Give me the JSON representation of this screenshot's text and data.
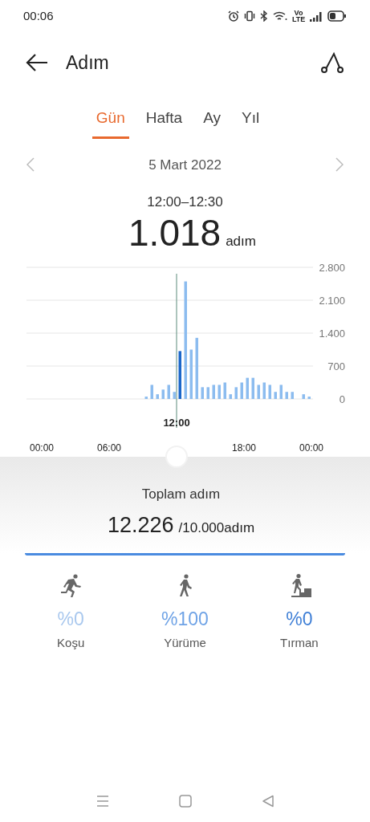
{
  "status_bar": {
    "time": "00:06",
    "volte": "Vo LTE"
  },
  "header": {
    "title": "Adım"
  },
  "tabs": [
    {
      "label": "Gün",
      "selected": true
    },
    {
      "label": "Hafta",
      "selected": false
    },
    {
      "label": "Ay",
      "selected": false
    },
    {
      "label": "Yıl",
      "selected": false
    }
  ],
  "date_nav": {
    "date": "5 Mart 2022"
  },
  "selection": {
    "range": "12:00–12:30",
    "value": "1.018",
    "unit": "adım"
  },
  "chart_data": {
    "type": "bar",
    "x": [
      9,
      9.5,
      10,
      10.5,
      11,
      11.5,
      12,
      12.5,
      13,
      13.5,
      14,
      14.5,
      15,
      15.5,
      16,
      16.5,
      17,
      17.5,
      18,
      18.5,
      19,
      19.5,
      20,
      20.5,
      21,
      21.5,
      22,
      23,
      23.5
    ],
    "series": [
      {
        "color": "#8cbcef",
        "values": [
          50,
          300,
          100,
          200,
          300,
          150,
          null,
          2500,
          1050,
          1300,
          250,
          250,
          300,
          300,
          350,
          100,
          250,
          350,
          450,
          450,
          300,
          350,
          300,
          150,
          300,
          150,
          150,
          100,
          50
        ]
      },
      {
        "color": "#1a66c9",
        "values": [
          null,
          null,
          null,
          null,
          null,
          null,
          1018,
          null,
          null,
          null,
          null,
          null,
          null,
          null,
          null,
          null,
          null,
          null,
          null,
          null,
          null,
          null,
          null,
          null,
          null,
          null,
          null,
          null,
          null
        ]
      }
    ],
    "stacked": true,
    "grid": true,
    "xlim": [
      0,
      24
    ],
    "ylim": [
      0,
      2800
    ],
    "yticks": [
      {
        "value": 0,
        "label": "0"
      },
      {
        "value": 700,
        "label": "700"
      },
      {
        "value": 1400,
        "label": "1.400"
      },
      {
        "value": 2100,
        "label": "2.100"
      },
      {
        "value": 2800,
        "label": "2.800"
      }
    ],
    "xticks": [
      {
        "value": 0,
        "label": "00:00"
      },
      {
        "value": 6,
        "label": "06:00"
      },
      {
        "value": 18,
        "label": "18:00"
      },
      {
        "value": 24,
        "label": "00:00"
      }
    ],
    "annotations": [
      {
        "x": 12,
        "text": "12:00"
      }
    ]
  },
  "summary": {
    "title": "Toplam adım",
    "total": "12.226",
    "goal": "/10.000adım",
    "level": 1
  },
  "activities": [
    {
      "kind": "run",
      "value": "%0",
      "label": "Koşu",
      "color": "#a9c8ee"
    },
    {
      "kind": "walk",
      "value": "%100",
      "label": "Yürüme",
      "color": "#6fa3e6"
    },
    {
      "kind": "climb",
      "value": "%0",
      "label": "Tırman",
      "color": "#3f7fd6"
    }
  ]
}
